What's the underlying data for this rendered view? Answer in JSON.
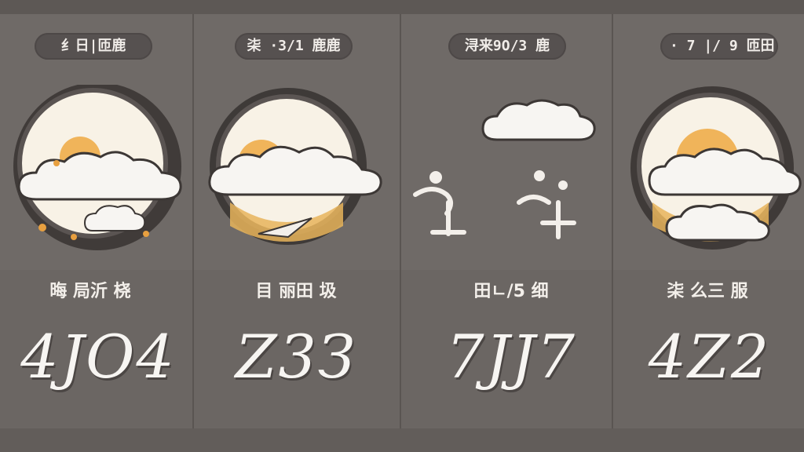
{
  "panels": [
    {
      "label": "纟日|匝鹿",
      "condition": "晦 局沂 桡",
      "temperature": "4JO4",
      "icon": "partly-sunny-icon"
    },
    {
      "label": "㭍 ·3/1 鹿鹿",
      "condition": "目 丽田 圾",
      "temperature": "Z3З",
      "icon": "sunny-cloudy-icon"
    },
    {
      "label": "浔来9O/3 鹿",
      "condition": "田ㄴ/5 细",
      "temperature": "7JJ7",
      "icon": "windy-cloudy-icon"
    },
    {
      "label": "· 7 |/ 9 匝田",
      "condition": "㭍 么三 服",
      "temperature": "4Z2",
      "icon": "sunny-cloudy-icon"
    }
  ],
  "colors": {
    "background": "#6e6966",
    "panel": "#6f6a67",
    "pill": "#565150",
    "sun": "#f0b45a",
    "cloud": "#f6f4f1"
  }
}
